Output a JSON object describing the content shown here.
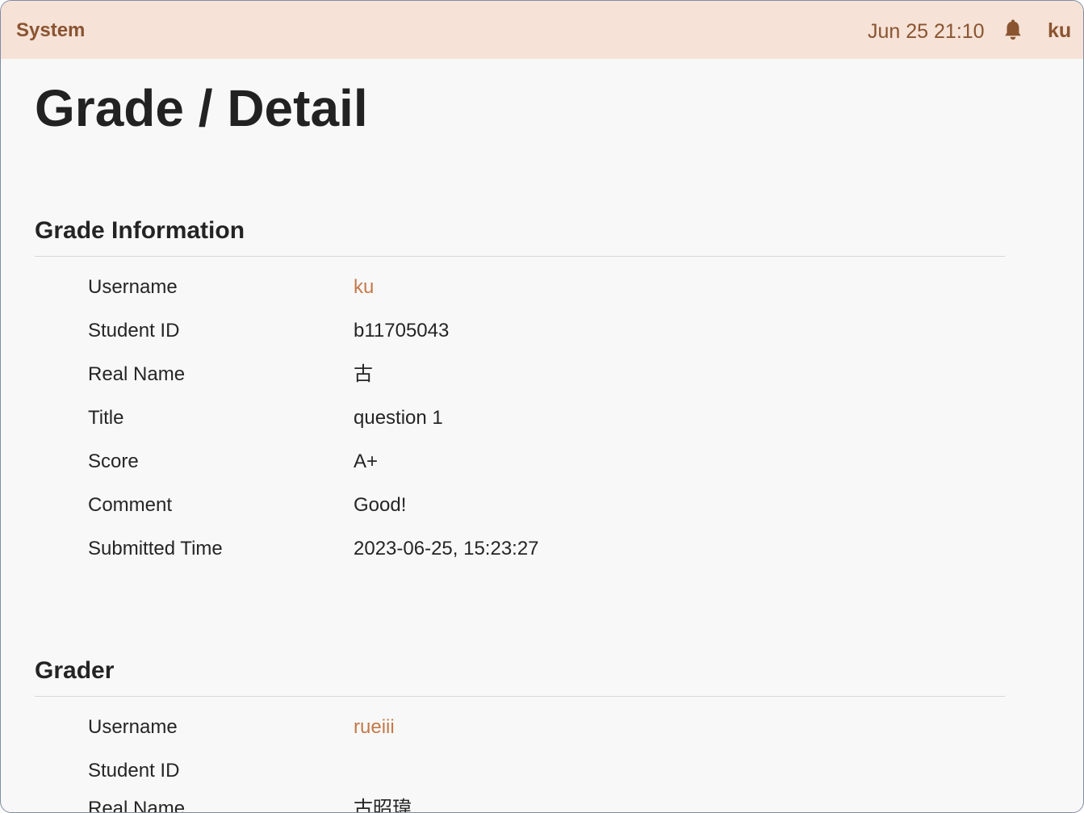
{
  "header": {
    "brand": "System",
    "datetime": "Jun 25 21:10",
    "notification_icon": "bell-icon",
    "username": "ku"
  },
  "page": {
    "title": "Grade / Detail"
  },
  "grade_information": {
    "heading": "Grade Information",
    "fields": [
      {
        "label": "Username",
        "value": "ku"
      },
      {
        "label": "Student ID",
        "value": "b11705043"
      },
      {
        "label": "Real Name",
        "value": "古"
      },
      {
        "label": "Title",
        "value": "question 1"
      },
      {
        "label": "Score",
        "value": "A+"
      },
      {
        "label": "Comment",
        "value": "Good!"
      },
      {
        "label": "Submitted Time",
        "value": "2023-06-25, 15:23:27"
      }
    ]
  },
  "grader": {
    "heading": "Grader",
    "fields": [
      {
        "label": "Username",
        "value": "rueiii"
      },
      {
        "label": "Student ID",
        "value": ""
      },
      {
        "label": "Real Name",
        "value": "古昭瑋"
      }
    ]
  },
  "colors": {
    "header_background": "#f6e2d6",
    "header_text": "#8a5431",
    "link": "#c4794a",
    "page_background": "#f8f8f8"
  }
}
